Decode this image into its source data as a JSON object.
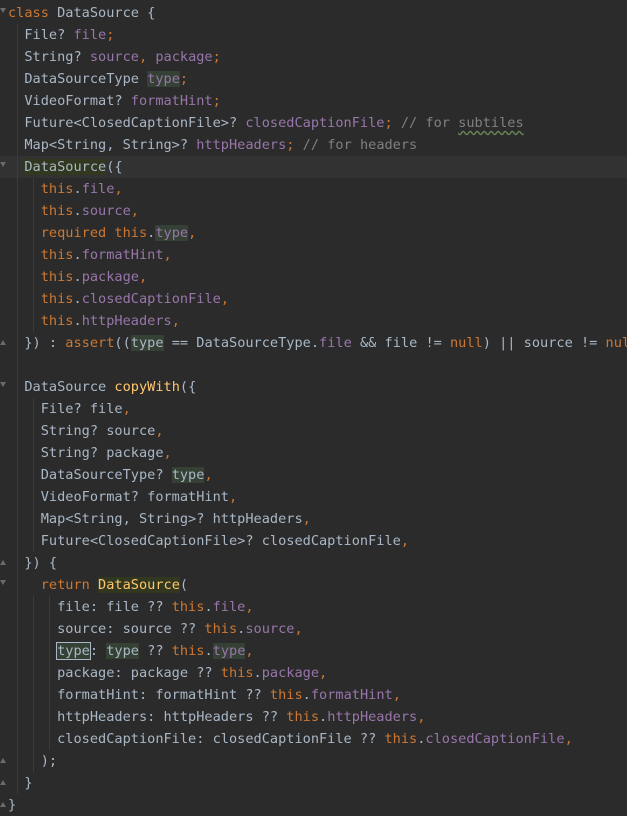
{
  "editor": {
    "language": "dart",
    "colors": {
      "background": "#2b2b2b",
      "keyword": "#cc7832",
      "field": "#9876aa",
      "function": "#ffc66d",
      "comment": "#808080",
      "identifier": "#a9b7c6",
      "highlight": "#344134"
    },
    "lines": [
      [
        [
          "kw",
          "class"
        ],
        [
          "typ",
          " DataSource {"
        ]
      ],
      [
        [
          "typ",
          "  File? "
        ],
        [
          "fld",
          "file"
        ],
        [
          "kw",
          ";"
        ]
      ],
      [
        [
          "typ",
          "  String? "
        ],
        [
          "fld",
          "source"
        ],
        [
          "kw",
          ", "
        ],
        [
          "fld",
          "package"
        ],
        [
          "kw",
          ";"
        ]
      ],
      [
        [
          "typ",
          "  DataSourceType "
        ],
        [
          "hl-f",
          "type"
        ],
        [
          "kw",
          ";"
        ]
      ],
      [
        [
          "typ",
          "  VideoFormat? "
        ],
        [
          "fld",
          "formatHint"
        ],
        [
          "kw",
          ";"
        ]
      ],
      [
        [
          "typ",
          "  Future<ClosedCaptionFile>? "
        ],
        [
          "fld",
          "closedCaptionFile"
        ],
        [
          "kw",
          "; "
        ],
        [
          "com",
          "// for "
        ],
        [
          "com-wavy",
          "subtiles"
        ]
      ],
      [
        [
          "typ",
          "  Map<String, String>? "
        ],
        [
          "fld",
          "httpHeaders"
        ],
        [
          "kw",
          "; "
        ],
        [
          "com",
          "// for headers"
        ]
      ],
      [
        [
          "typ",
          "  "
        ],
        [
          "cls-hl",
          "DataSource"
        ],
        [
          "typ",
          "({"
        ]
      ],
      [
        [
          "typ",
          "    "
        ],
        [
          "kw",
          "this"
        ],
        [
          "typ",
          "."
        ],
        [
          "fld",
          "file"
        ],
        [
          "kw",
          ","
        ]
      ],
      [
        [
          "typ",
          "    "
        ],
        [
          "kw",
          "this"
        ],
        [
          "typ",
          "."
        ],
        [
          "fld",
          "source"
        ],
        [
          "kw",
          ","
        ]
      ],
      [
        [
          "typ",
          "    "
        ],
        [
          "kw",
          "required this"
        ],
        [
          "typ",
          "."
        ],
        [
          "hl-f",
          "type"
        ],
        [
          "kw",
          ","
        ]
      ],
      [
        [
          "typ",
          "    "
        ],
        [
          "kw",
          "this"
        ],
        [
          "typ",
          "."
        ],
        [
          "fld",
          "formatHint"
        ],
        [
          "kw",
          ","
        ]
      ],
      [
        [
          "typ",
          "    "
        ],
        [
          "kw",
          "this"
        ],
        [
          "typ",
          "."
        ],
        [
          "fld",
          "package"
        ],
        [
          "kw",
          ","
        ]
      ],
      [
        [
          "typ",
          "    "
        ],
        [
          "kw",
          "this"
        ],
        [
          "typ",
          "."
        ],
        [
          "fld",
          "closedCaptionFile"
        ],
        [
          "kw",
          ","
        ]
      ],
      [
        [
          "typ",
          "    "
        ],
        [
          "kw",
          "this"
        ],
        [
          "typ",
          "."
        ],
        [
          "fld",
          "httpHeaders"
        ],
        [
          "kw",
          ","
        ]
      ],
      [
        [
          "typ",
          "  }) : "
        ],
        [
          "kw",
          "assert"
        ],
        [
          "typ",
          "(("
        ],
        [
          "hl",
          "type"
        ],
        [
          "typ",
          " == DataSourceType."
        ],
        [
          "fld",
          "file"
        ],
        [
          "typ",
          " && file != "
        ],
        [
          "kw",
          "null"
        ],
        [
          "typ",
          ") || source != "
        ],
        [
          "kw",
          "null"
        ],
        [
          "kw",
          ");"
        ]
      ],
      [
        [
          "typ",
          ""
        ]
      ],
      [
        [
          "typ",
          "  DataSource "
        ],
        [
          "fn",
          "copyWith"
        ],
        [
          "typ",
          "({"
        ]
      ],
      [
        [
          "typ",
          "    File? file"
        ],
        [
          "kw",
          ","
        ]
      ],
      [
        [
          "typ",
          "    String? source"
        ],
        [
          "kw",
          ","
        ]
      ],
      [
        [
          "typ",
          "    String? package"
        ],
        [
          "kw",
          ","
        ]
      ],
      [
        [
          "typ",
          "    DataSourceType? "
        ],
        [
          "hl",
          "type"
        ],
        [
          "kw",
          ","
        ]
      ],
      [
        [
          "typ",
          "    VideoFormat? formatHint"
        ],
        [
          "kw",
          ","
        ]
      ],
      [
        [
          "typ",
          "    Map<String, String>? httpHeaders"
        ],
        [
          "kw",
          ","
        ]
      ],
      [
        [
          "typ",
          "    Future<ClosedCaptionFile>? closedCaptionFile"
        ],
        [
          "kw",
          ","
        ]
      ],
      [
        [
          "typ",
          "  }) {"
        ]
      ],
      [
        [
          "typ",
          "    "
        ],
        [
          "kw",
          "return "
        ],
        [
          "cls-hl-fn",
          "DataSource"
        ],
        [
          "typ",
          "("
        ]
      ],
      [
        [
          "typ",
          "      file: file ?? "
        ],
        [
          "kw",
          "this"
        ],
        [
          "typ",
          "."
        ],
        [
          "fld",
          "file"
        ],
        [
          "kw",
          ","
        ]
      ],
      [
        [
          "typ",
          "      source: source ?? "
        ],
        [
          "kw",
          "this"
        ],
        [
          "typ",
          "."
        ],
        [
          "fld",
          "source"
        ],
        [
          "kw",
          ","
        ]
      ],
      [
        [
          "box",
          "type"
        ],
        [
          "typ",
          ": "
        ],
        [
          "hl",
          "type"
        ],
        [
          "typ",
          " ?? "
        ],
        [
          "kw",
          "this"
        ],
        [
          "typ",
          "."
        ],
        [
          "hl-f",
          "type"
        ],
        [
          "kw",
          ","
        ]
      ],
      [
        [
          "typ",
          "      package: package ?? "
        ],
        [
          "kw",
          "this"
        ],
        [
          "typ",
          "."
        ],
        [
          "fld",
          "package"
        ],
        [
          "kw",
          ","
        ]
      ],
      [
        [
          "typ",
          "      formatHint: formatHint ?? "
        ],
        [
          "kw",
          "this"
        ],
        [
          "typ",
          "."
        ],
        [
          "fld",
          "formatHint"
        ],
        [
          "kw",
          ","
        ]
      ],
      [
        [
          "typ",
          "      httpHeaders: httpHeaders ?? "
        ],
        [
          "kw",
          "this"
        ],
        [
          "typ",
          "."
        ],
        [
          "fld",
          "httpHeaders"
        ],
        [
          "kw",
          ","
        ]
      ],
      [
        [
          "typ",
          "      closedCaptionFile: closedCaptionFile ?? "
        ],
        [
          "kw",
          "this"
        ],
        [
          "typ",
          "."
        ],
        [
          "fld",
          "closedCaptionFile"
        ],
        [
          "kw",
          ","
        ]
      ],
      [
        [
          "typ",
          "    );"
        ]
      ],
      [
        [
          "typ",
          "  }"
        ]
      ],
      [
        [
          "typ",
          "}"
        ]
      ]
    ]
  }
}
